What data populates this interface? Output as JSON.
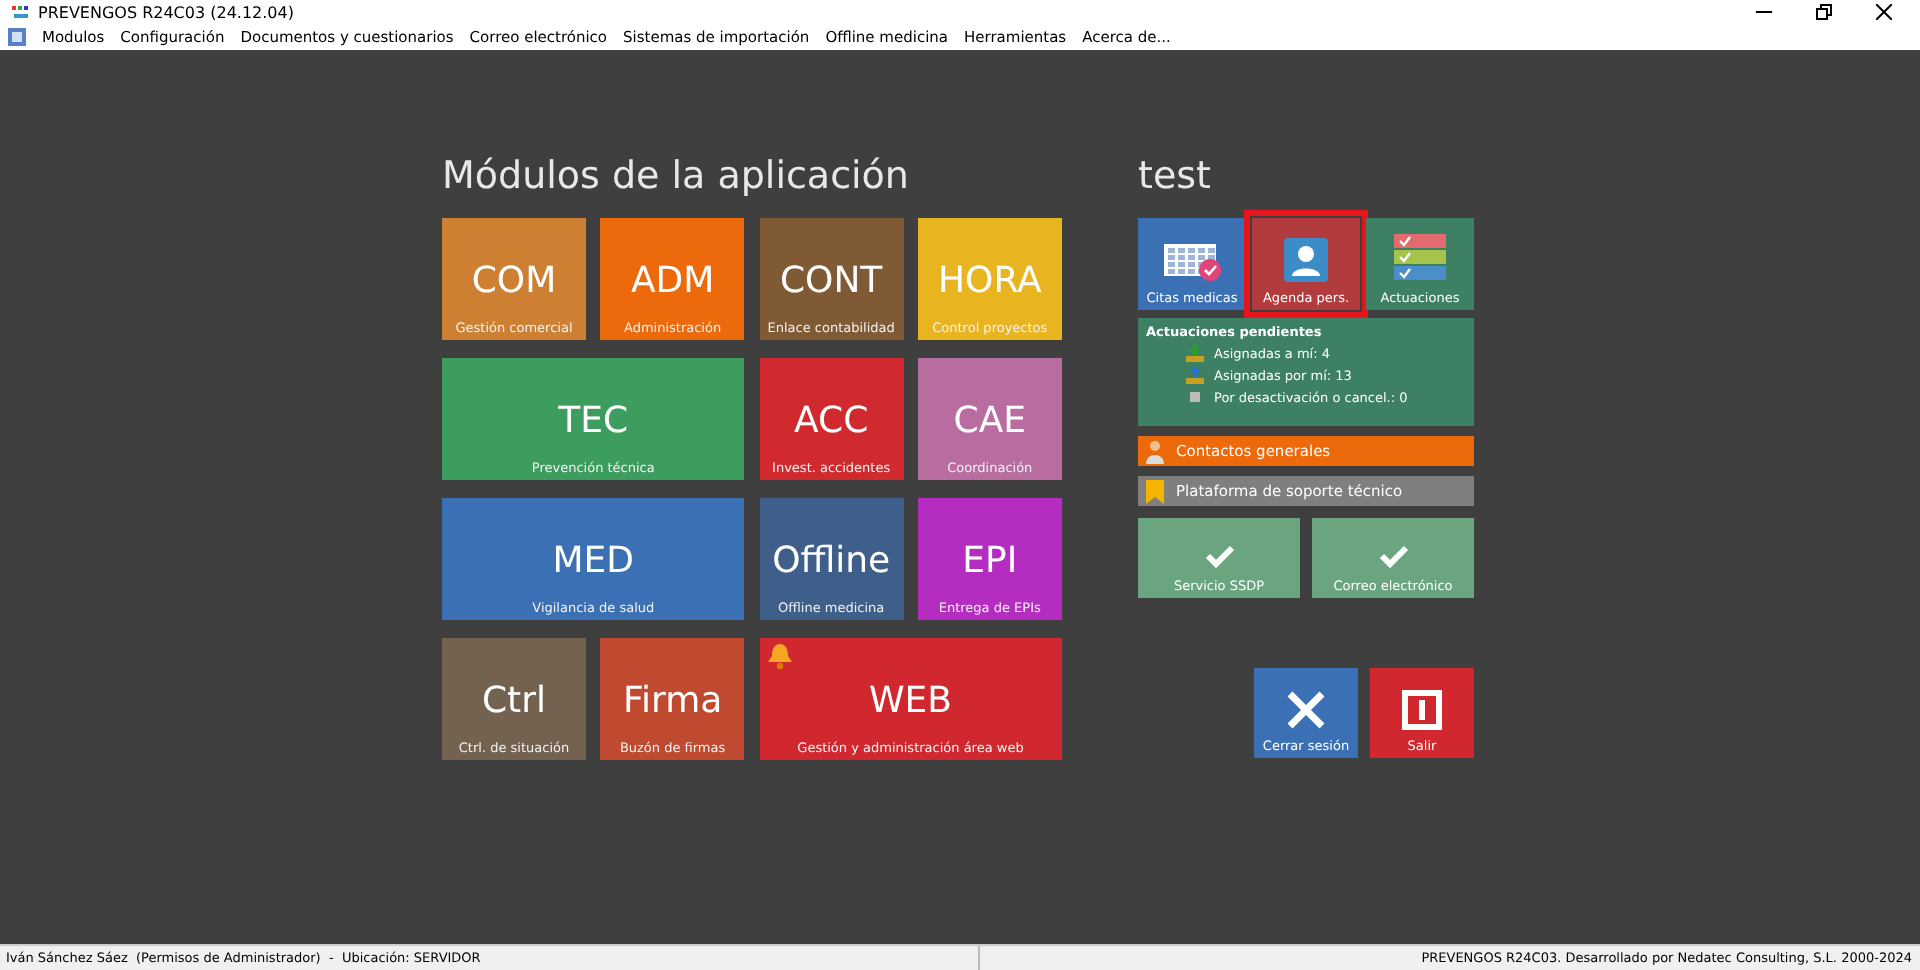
{
  "window": {
    "title": "PREVENGOS R24C03 (24.12.04)"
  },
  "menu": [
    "Modulos",
    "Configuración",
    "Documentos y cuestionarios",
    "Correo electrónico",
    "Sistemas de importación",
    "Offline medicina",
    "Herramientas",
    "Acerca de..."
  ],
  "modules": {
    "heading": "Módulos de la aplicación",
    "tiles": [
      {
        "code": "COM",
        "label": "Gestión comercial",
        "color": "#cd7f32",
        "kind": "normal",
        "notification": false
      },
      {
        "code": "ADM",
        "label": "Administración",
        "color": "#ec6a0c",
        "kind": "normal",
        "notification": false
      },
      {
        "code": "CONT",
        "label": "Enlace contabilidad",
        "color": "#7f5a35",
        "kind": "normal",
        "notification": false
      },
      {
        "code": "HORA",
        "label": "Control proyectos",
        "color": "#e8b520",
        "kind": "normal",
        "notification": false
      },
      {
        "code": "TEC",
        "label": "Prevención técnica",
        "color": "#3c9d5f",
        "kind": "wide",
        "notification": false
      },
      {
        "code": "ACC",
        "label": "Invest. accidentes",
        "color": "#d02a2f",
        "kind": "normal",
        "notification": false
      },
      {
        "code": "CAE",
        "label": "Coordinación",
        "color": "#b86ca0",
        "kind": "normal",
        "notification": false
      },
      {
        "code": "MED",
        "label": "Vigilancia de salud",
        "color": "#3c70b5",
        "kind": "wide",
        "notification": false
      },
      {
        "code": "Offline",
        "label": "Offline medicina",
        "color": "#3d5f89",
        "kind": "normal",
        "notification": false
      },
      {
        "code": "EPI",
        "label": "Entrega de EPIs",
        "color": "#b42cc0",
        "kind": "normal",
        "notification": false
      },
      {
        "code": "Ctrl",
        "label": "Ctrl. de situación",
        "color": "#73624f",
        "kind": "normal",
        "notification": false
      },
      {
        "code": "Firma",
        "label": "Buzón de firmas",
        "color": "#c04a30",
        "kind": "normal",
        "notification": false
      },
      {
        "code": "WEB",
        "label": "Gestión y administración área web",
        "color": "#d0282e",
        "kind": "wide",
        "notification": true
      }
    ]
  },
  "user_panel": {
    "heading": "test",
    "quick_tiles": [
      {
        "kind": "calendar",
        "label": "Citas medicas",
        "color": "#3c70b5",
        "selected": false
      },
      {
        "kind": "person",
        "label": "Agenda pers.",
        "color": "#b23b3e",
        "selected": true
      },
      {
        "kind": "checklist",
        "label": "Actuaciones",
        "color": "#3d8063",
        "selected": false
      }
    ],
    "pending": {
      "title": "Actuaciones pendientes",
      "items": [
        {
          "kind": "down",
          "text": "Asignadas a mí: 4"
        },
        {
          "kind": "up",
          "text": "Asignadas por mí: 13"
        },
        {
          "kind": "square",
          "text": "Por desactivación o cancel.: 0"
        }
      ]
    },
    "links": [
      {
        "kind": "contacts",
        "label": "Contactos generales",
        "color": "#ec6a0c"
      },
      {
        "kind": "support",
        "label": "Plataforma de soporte técnico",
        "color": "#7f7f7f"
      }
    ],
    "services": [
      {
        "label": "Servicio SSDP",
        "ok": true
      },
      {
        "label": "Correo electrónico",
        "ok": true
      }
    ],
    "actions": [
      {
        "kind": "logout",
        "label": "Cerrar sesión",
        "color": "#3c70b5"
      },
      {
        "kind": "exit",
        "label": "Salir",
        "color": "#d0282e"
      }
    ]
  },
  "status_bar": {
    "left": "Iván Sánchez Sáez  (Permisos de Administrador)  -  Ubicación: SERVIDOR",
    "right": "PREVENGOS R24C03. Desarrollado por Nedatec Consulting, S.L. 2000-2024"
  }
}
